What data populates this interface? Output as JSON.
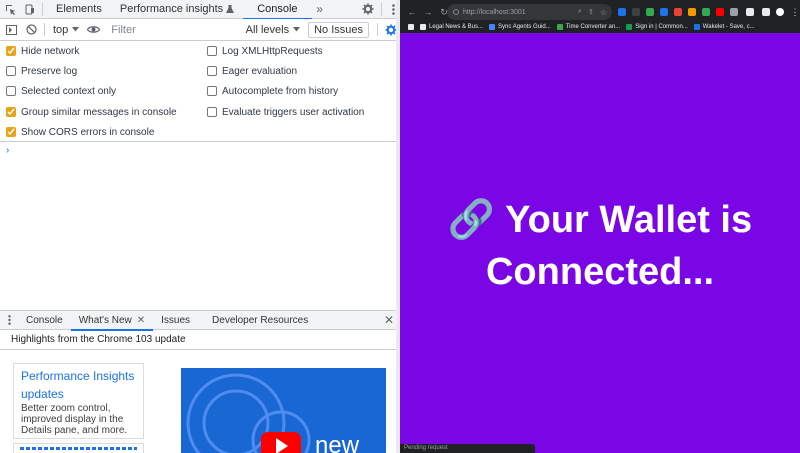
{
  "devtools": {
    "tabs": [
      {
        "label": "Elements"
      },
      {
        "label": "Performance insights"
      },
      {
        "label": "Console"
      }
    ],
    "toolbar": {
      "context": "top",
      "filter_placeholder": "Filter",
      "levels": "All levels",
      "issues": "No Issues"
    },
    "settings": [
      {
        "label": "Hide network",
        "checked": true
      },
      {
        "label": "Preserve log",
        "checked": false
      },
      {
        "label": "Selected context only",
        "checked": false
      },
      {
        "label": "Group similar messages in console",
        "checked": true
      },
      {
        "label": "Show CORS errors in console",
        "checked": true
      },
      {
        "label": "Log XMLHttpRequests",
        "checked": false
      },
      {
        "label": "Eager evaluation",
        "checked": false
      },
      {
        "label": "Autocomplete from history",
        "checked": false
      },
      {
        "label": "Evaluate triggers user activation",
        "checked": false
      }
    ],
    "prompt": "›",
    "drawer": {
      "tabs": [
        {
          "label": "Console"
        },
        {
          "label": "What's New"
        },
        {
          "label": "Issues"
        },
        {
          "label": "Developer Resources"
        }
      ],
      "heading": "Highlights from the Chrome 103 update",
      "card": {
        "title": "Performance Insights updates",
        "description": "Better zoom control, improved display in the Details pane, and more."
      },
      "video_text": "new"
    }
  },
  "browser": {
    "url": "http://localhost:3001",
    "bookmarks": [
      {
        "label": "Legal News & Bus...",
        "color": "#e8eaed"
      },
      {
        "label": "Sync Agents Guid...",
        "color": "#4285f4"
      },
      {
        "label": "Time Converter an...",
        "color": "#34a853"
      },
      {
        "label": "Sign in | Common...",
        "color": "#0f9d58"
      },
      {
        "label": "Wakelet - Save, c...",
        "color": "#1a73e8"
      }
    ],
    "heading_emoji": "🔗",
    "heading": "Your Wallet is Connected...",
    "status": "Pending request",
    "background": "#7a06e6"
  }
}
